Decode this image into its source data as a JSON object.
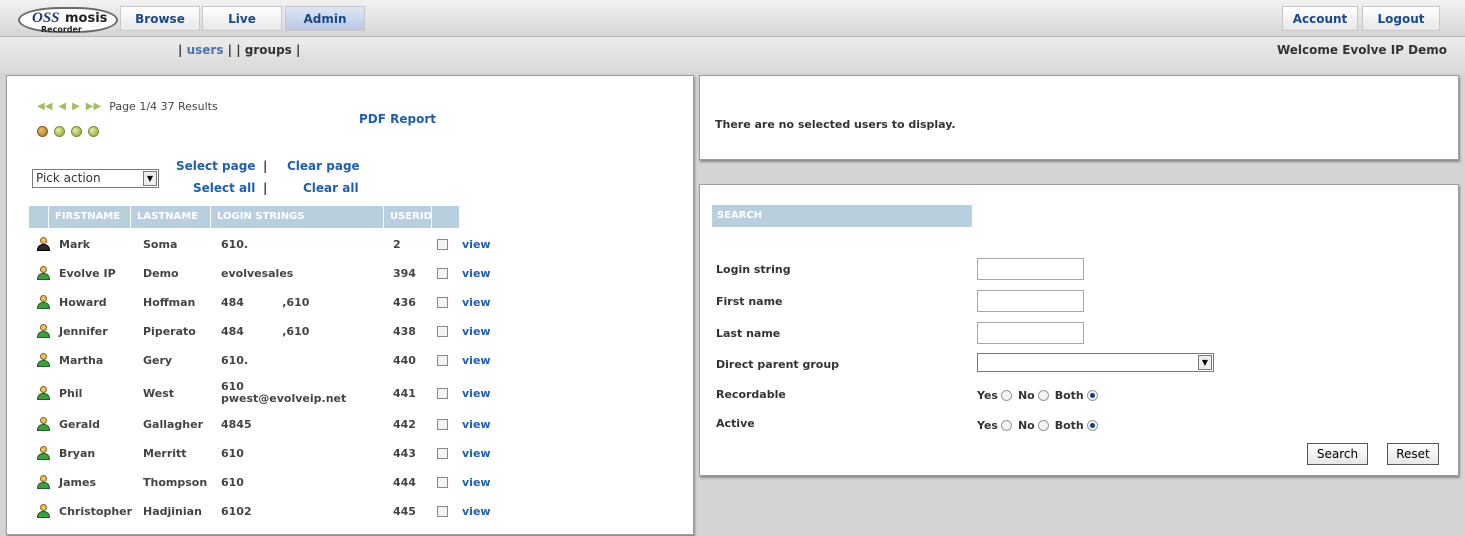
{
  "logo": {
    "brand_italic": "OSS",
    "brand_bold": "mosis",
    "sub": "Recorder"
  },
  "nav": {
    "browse": "Browse",
    "live": "Live",
    "admin": "Admin",
    "account": "Account",
    "logout": "Logout"
  },
  "subnav": {
    "sep_open": "|",
    "users": "users",
    "sep_mid": "| |",
    "groups": "groups",
    "sep_close": "|"
  },
  "welcome": "Welcome Evolve IP Demo",
  "pager": {
    "first": "◀◀",
    "prev": "◀",
    "next": "▶",
    "last": "▶▶",
    "text": "Page 1/4 37 Results"
  },
  "pdf_report": "PDF Report",
  "pick_action": "Pick action",
  "selection": {
    "select_page": "Select page",
    "clear_page": "Clear page",
    "select_all": "Select all",
    "clear_all": "Clear all",
    "sep": "|"
  },
  "table": {
    "headers": [
      "FIRSTNAME",
      "LASTNAME",
      "LOGIN STRINGS",
      "USERID"
    ],
    "rows": [
      {
        "first": "Mark",
        "last": "Soma",
        "login": "610.",
        "login2": "",
        "userid": "2",
        "action": "view"
      },
      {
        "first": "Evolve IP",
        "last": "Demo",
        "login": "evolvesales",
        "login2": "",
        "userid": "394",
        "action": "view"
      },
      {
        "first": "Howard",
        "last": "Hoffman",
        "login": "484          ,610",
        "login2": "",
        "userid": "436",
        "action": "view"
      },
      {
        "first": "Jennifer",
        "last": "Piperato",
        "login": "484          ,610",
        "login2": "",
        "userid": "438",
        "action": "view"
      },
      {
        "first": "Martha",
        "last": "Gery",
        "login": "610.",
        "login2": "",
        "userid": "440",
        "action": "view"
      },
      {
        "first": "Phil",
        "last": "West",
        "login": "610",
        "login2": "pwest@evolveip.net",
        "userid": "441",
        "action": "view"
      },
      {
        "first": "Gerald",
        "last": "Gallagher",
        "login": "4845",
        "login2": "",
        "userid": "442",
        "action": "view"
      },
      {
        "first": "Bryan",
        "last": "Merritt",
        "login": "610",
        "login2": "",
        "userid": "443",
        "action": "view"
      },
      {
        "first": "James",
        "last": "Thompson",
        "login": "610",
        "login2": "",
        "userid": "444",
        "action": "view"
      },
      {
        "first": "Christopher",
        "last": "Hadjinian",
        "login": "6102",
        "login2": "",
        "userid": "445",
        "action": "view"
      }
    ]
  },
  "selected_users_msg": "There are no selected users to display.",
  "search": {
    "header": "SEARCH",
    "login_label": "Login string",
    "first_label": "First name",
    "last_label": "Last name",
    "group_label": "Direct parent group",
    "recordable_label": "Recordable",
    "active_label": "Active",
    "yes": "Yes",
    "no": "No",
    "both": "Both",
    "search_btn": "Search",
    "reset_btn": "Reset"
  }
}
